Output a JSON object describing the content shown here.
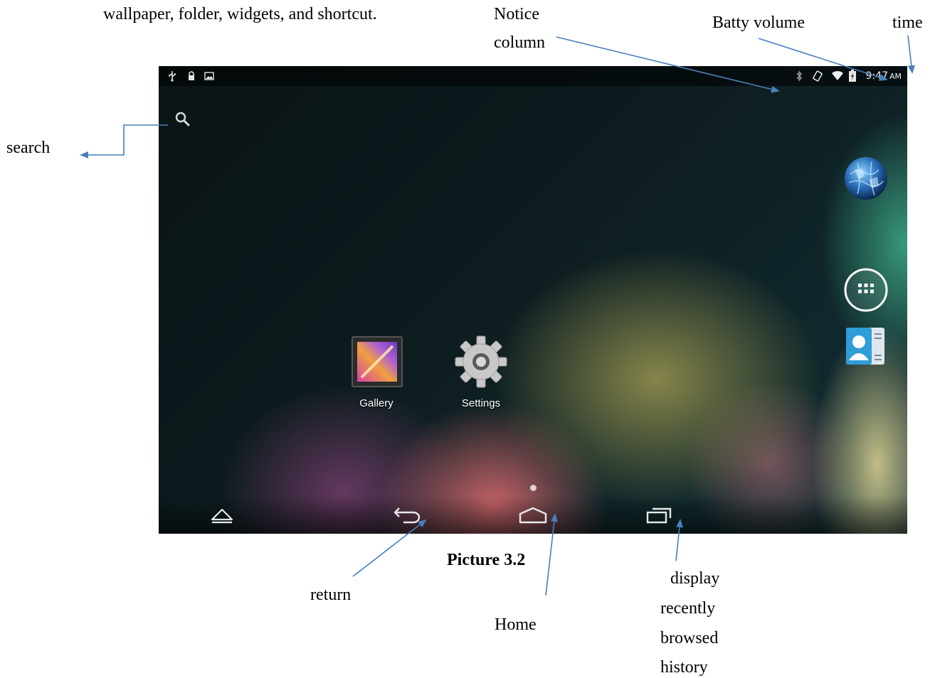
{
  "document": {
    "intro_text": "wallpaper, folder, widgets, and shortcut.",
    "caption": "Picture 3.2"
  },
  "annotations": {
    "notice_line1": "Notice",
    "notice_line2": "column",
    "battery": "Batty volume",
    "time": "time",
    "search": "search",
    "return": "return",
    "home": "Home",
    "history_line1": "display",
    "history_line2": "recently",
    "history_line3": "browsed",
    "history_line4": "history"
  },
  "screen": {
    "status_bar": {
      "left_icons": [
        "usb-icon",
        "lock-icon",
        "image-icon"
      ],
      "right_icons": [
        "bluetooth-icon",
        "rotate-icon",
        "wifi-icon",
        "battery-icon"
      ],
      "time": "9:47",
      "ampm": "AM"
    },
    "apps": {
      "gallery": "Gallery",
      "settings": "Settings"
    },
    "dock": [
      "browser-globe-icon",
      "app-drawer-icon",
      "contacts-icon"
    ],
    "nav_buttons": [
      "up-icon",
      "back-icon",
      "home-icon",
      "recents-icon"
    ]
  },
  "colors": {
    "arrow": "#4a7ebb",
    "statusbar_bg": "#000000",
    "status_text": "#e6e6e6"
  }
}
